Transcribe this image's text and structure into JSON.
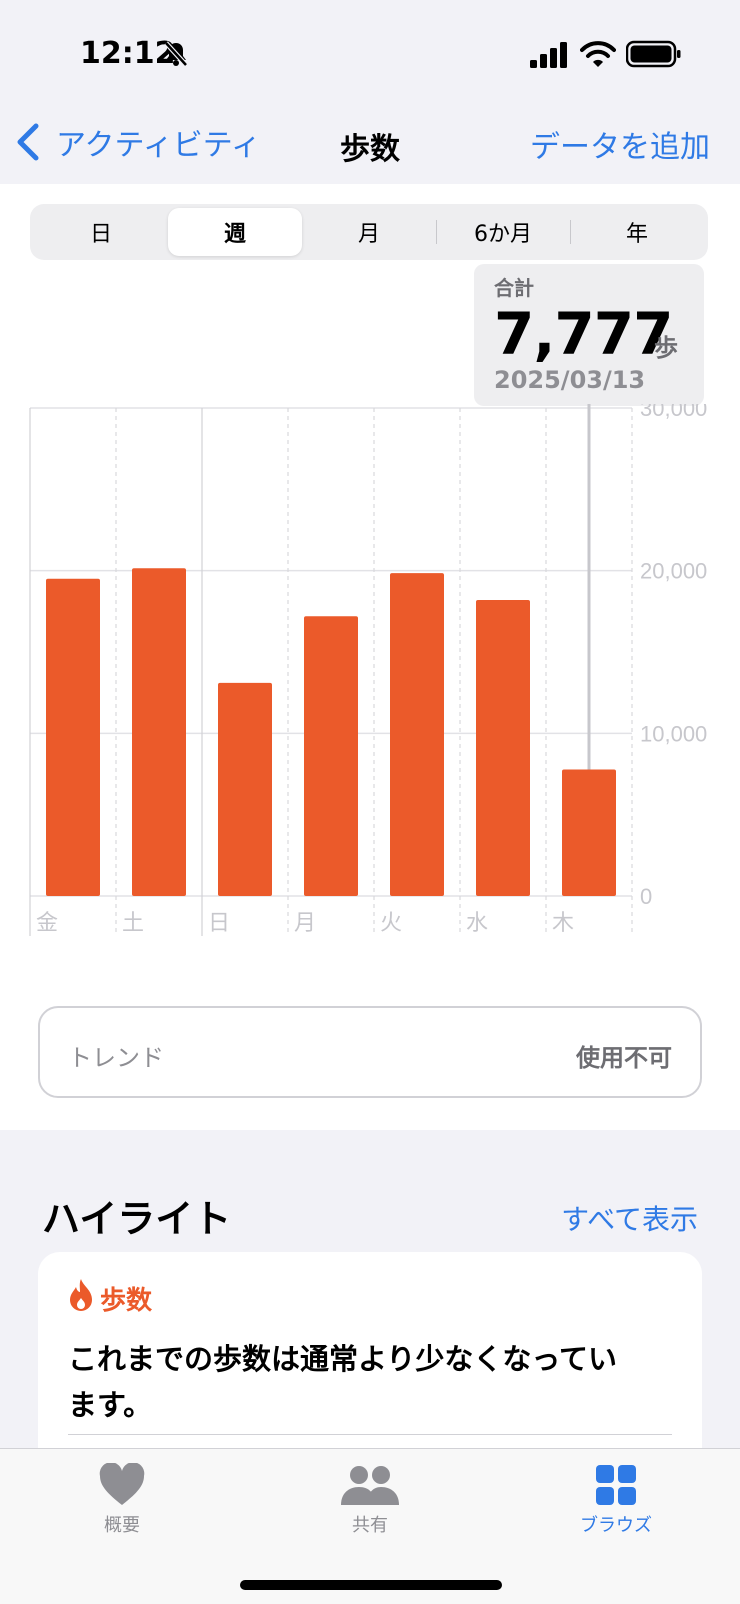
{
  "status_bar": {
    "time": "12:12"
  },
  "nav": {
    "back_label": "アクティビティ",
    "title": "歩数",
    "add_label": "データを追加"
  },
  "segments": [
    "日",
    "週",
    "月",
    "6か月",
    "年"
  ],
  "selected_segment": "週",
  "callout": {
    "label": "合計",
    "value": "7,777",
    "unit": "歩",
    "date": "2025/03/13"
  },
  "chart_data": {
    "type": "bar",
    "categories": [
      "金",
      "土",
      "日",
      "月",
      "火",
      "水",
      "木"
    ],
    "values": [
      19500,
      20150,
      13100,
      17200,
      19850,
      18200,
      7777
    ],
    "y_ticks": [
      "0",
      "10,000",
      "20,000",
      "30,000"
    ],
    "ylim": [
      0,
      30000
    ],
    "highlighted_index": 6,
    "bar_color": "#eb5a2a"
  },
  "trend": {
    "label": "トレンド",
    "value": "使用不可"
  },
  "highlights": {
    "title": "ハイライト",
    "show_all": "すべて表示",
    "card": {
      "category": "歩数",
      "message": "これまでの歩数は通常より少なくなっています。"
    }
  },
  "tabs": [
    {
      "label": "概要",
      "icon": "heart-icon",
      "active": false
    },
    {
      "label": "共有",
      "icon": "people-icon",
      "active": false
    },
    {
      "label": "ブラウズ",
      "icon": "grid-icon",
      "active": true
    }
  ],
  "colors": {
    "accent": "#2f7ae5",
    "bar": "#eb5a2a",
    "inactive_tab": "#8e8e93"
  }
}
